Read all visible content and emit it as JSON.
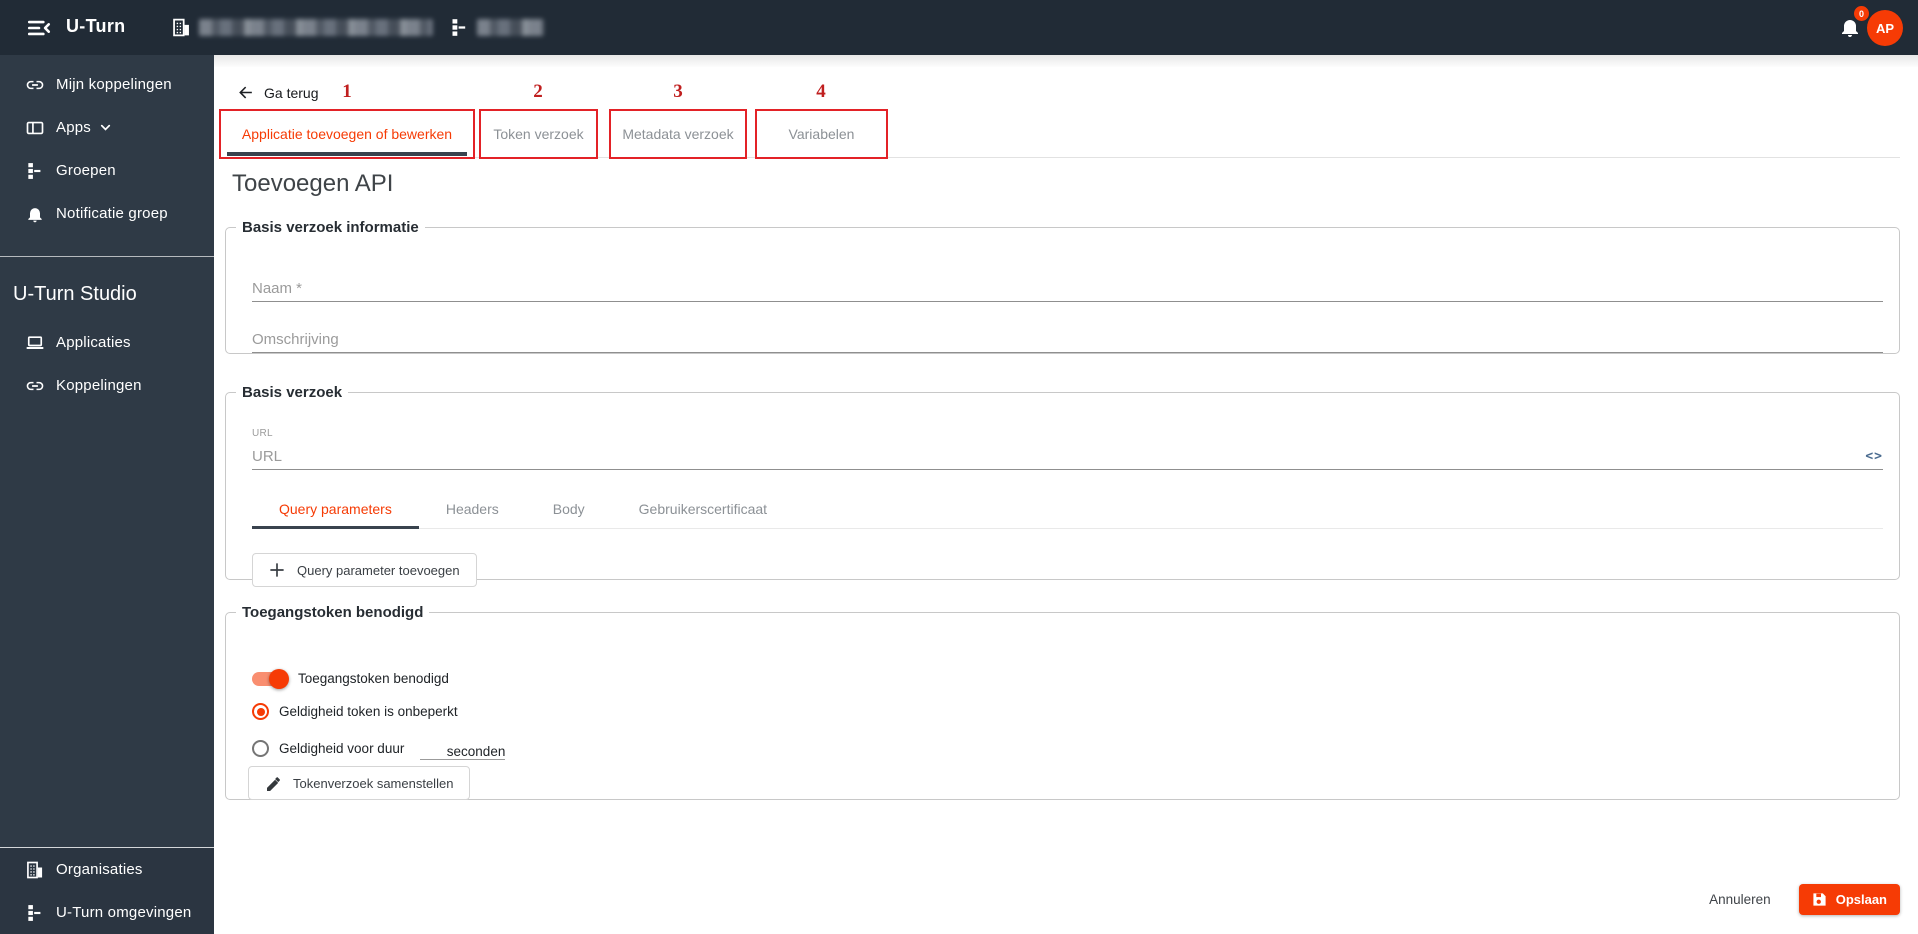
{
  "topbar": {
    "app_title": "U-Turn",
    "context_items": [
      {
        "icon": "building-icon",
        "redacted": true
      },
      {
        "icon": "hierarchy-icon",
        "redacted": true
      }
    ],
    "notifications_badge": "0",
    "avatar_initials": "AP"
  },
  "sidebar": {
    "items": [
      {
        "icon": "link-icon",
        "label": "Mijn koppelingen"
      },
      {
        "icon": "apps-icon",
        "label": "Apps",
        "expandable": true
      },
      {
        "icon": "hierarchy-icon",
        "label": "Groepen"
      },
      {
        "icon": "bell-icon",
        "label": "Notificatie groep"
      }
    ],
    "studio_header": "U-Turn Studio",
    "studio_items": [
      {
        "icon": "laptop-icon",
        "label": "Applicaties"
      },
      {
        "icon": "link-icon",
        "label": "Koppelingen"
      }
    ],
    "bottom_items": [
      {
        "icon": "building-icon",
        "label": "Organisaties"
      },
      {
        "icon": "hierarchy-icon",
        "label": "U-Turn omgevingen"
      }
    ]
  },
  "content": {
    "back_label": "Ga terug",
    "annotated_tabs": [
      {
        "number": "1",
        "label": "Applicatie toevoegen of bewerken",
        "active": true
      },
      {
        "number": "2",
        "label": "Token verzoek",
        "active": false
      },
      {
        "number": "3",
        "label": "Metadata verzoek",
        "active": false
      },
      {
        "number": "4",
        "label": "Variabelen",
        "active": false
      }
    ],
    "page_title": "Toevoegen API",
    "basic_info": {
      "legend": "Basis verzoek informatie",
      "name_placeholder": "Naam *",
      "description_placeholder": "Omschrijving"
    },
    "base_request": {
      "legend": "Basis verzoek",
      "url_label": "URL",
      "url_placeholder": "URL",
      "code_icon_glyph": "<>",
      "tabs": [
        {
          "label": "Query parameters",
          "active": true
        },
        {
          "label": "Headers",
          "active": false
        },
        {
          "label": "Body",
          "active": false
        },
        {
          "label": "Gebruikerscertificaat",
          "active": false
        }
      ],
      "add_param_label": "Query parameter toevoegen"
    },
    "token_section": {
      "legend": "Toegangstoken benodigd",
      "toggle_label": "Toegangstoken benodigd",
      "toggle_on": true,
      "radio_unlimited_label": "Geldigheid token is onbeperkt",
      "radio_duration_label": "Geldigheid voor duur",
      "duration_suffix": "seconden",
      "compose_button_label": "Tokenverzoek samenstellen"
    },
    "footer": {
      "cancel_label": "Annuleren",
      "save_label": "Opslaan"
    }
  },
  "colors": {
    "accent": "#f63b05",
    "annotation_red": "#e32227",
    "topbar_bg": "#212b36",
    "sidebar_bg": "#2f3a46"
  }
}
